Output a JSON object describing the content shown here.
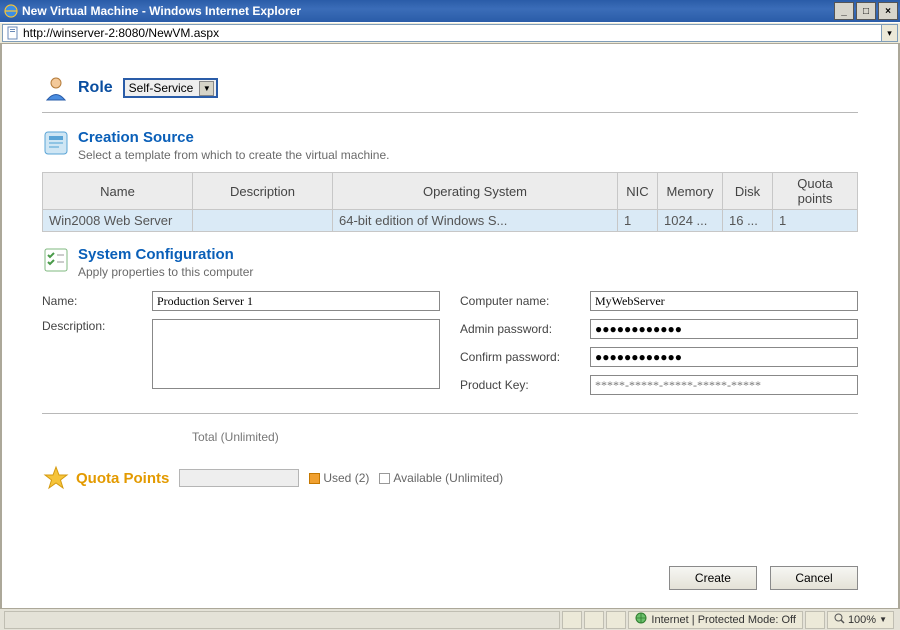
{
  "window": {
    "title": "New Virtual Machine - Windows Internet Explorer",
    "url": "http://winserver-2:8080/NewVM.aspx"
  },
  "role": {
    "label": "Role",
    "selected": "Self-Service"
  },
  "creation_source": {
    "title": "Creation Source",
    "subtitle": "Select a template from which to create the virtual machine.",
    "headers": {
      "name": "Name",
      "description": "Description",
      "os": "Operating System",
      "nic": "NIC",
      "memory": "Memory",
      "disk": "Disk",
      "quota": "Quota points"
    },
    "row": {
      "name": "Win2008 Web Server",
      "description": "",
      "os": "64-bit edition of Windows S...",
      "nic": "1",
      "memory": "1024 ...",
      "disk": "16 ...",
      "quota": "1"
    }
  },
  "sysconfig": {
    "title": "System Configuration",
    "subtitle": "Apply properties to this computer",
    "labels": {
      "name": "Name:",
      "description": "Description:",
      "computer_name": "Computer name:",
      "admin_password": "Admin password:",
      "confirm_password": "Confirm password:",
      "product_key": "Product Key:"
    },
    "values": {
      "name": "Production Server 1",
      "description": "",
      "computer_name": "MyWebServer",
      "admin_password": "●●●●●●●●●●●●",
      "confirm_password": "●●●●●●●●●●●●",
      "product_key_placeholder": "*****-*****-*****-*****-*****"
    }
  },
  "quota": {
    "label": "Quota Points",
    "total": "Total (Unlimited)",
    "used": "Used (2)",
    "available": "Available (Unlimited)"
  },
  "buttons": {
    "create": "Create",
    "cancel": "Cancel"
  },
  "statusbar": {
    "zone": "Internet | Protected Mode: Off",
    "zoom": "100%"
  }
}
